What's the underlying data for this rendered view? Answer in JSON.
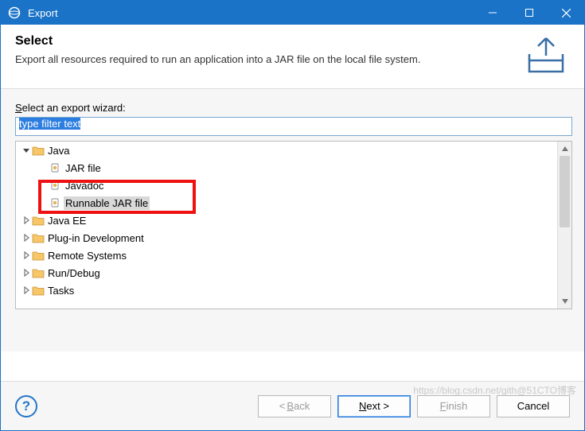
{
  "window": {
    "title": "Export"
  },
  "header": {
    "heading": "Select",
    "description": "Export all resources required to run an application into a JAR file on the local file system."
  },
  "wizard": {
    "label_prefix": "S",
    "label_rest": "elect an export wizard:",
    "filter_text": "type filter text"
  },
  "tree": {
    "items": [
      {
        "kind": "folder",
        "label": "Java",
        "depth": 0,
        "twisty": "down"
      },
      {
        "kind": "file",
        "label": "JAR file",
        "depth": 1
      },
      {
        "kind": "file",
        "label": "Javadoc",
        "depth": 1,
        "obscured": true
      },
      {
        "kind": "file",
        "label": "Runnable JAR file",
        "depth": 1,
        "selected": true
      },
      {
        "kind": "folder",
        "label": "Java EE",
        "depth": 0,
        "twisty": "right",
        "obscured": true
      },
      {
        "kind": "folder",
        "label": "Plug-in Development",
        "depth": 0,
        "twisty": "right"
      },
      {
        "kind": "folder",
        "label": "Remote Systems",
        "depth": 0,
        "twisty": "right"
      },
      {
        "kind": "folder",
        "label": "Run/Debug",
        "depth": 0,
        "twisty": "right"
      },
      {
        "kind": "folder",
        "label": "Tasks",
        "depth": 0,
        "twisty": "right"
      }
    ]
  },
  "buttons": {
    "back": "Back",
    "next": "Next >",
    "finish": "Finish",
    "cancel": "Cancel"
  },
  "watermark": "https://blog.csdn.net/gith@51CTO博客"
}
